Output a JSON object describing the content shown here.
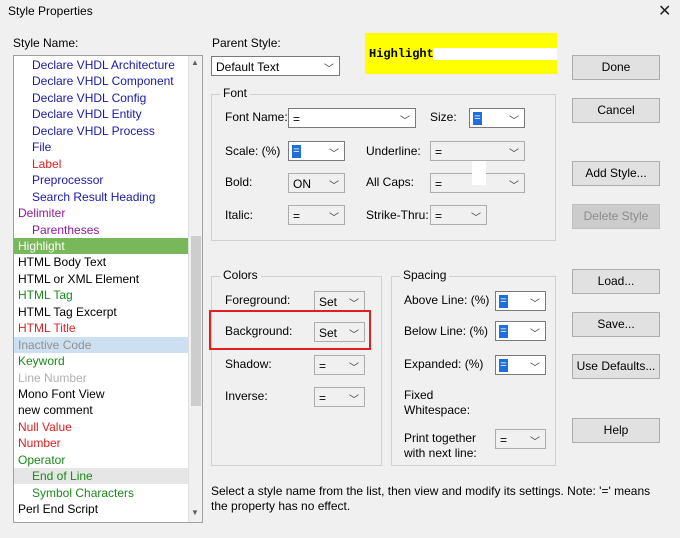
{
  "window": {
    "title": "Style Properties",
    "close_glyph": "✕"
  },
  "style_list": {
    "label": "Style Name:",
    "items": [
      {
        "label": "Declare VHDL Architecture",
        "color": "#1a1aa6",
        "indent": true
      },
      {
        "label": "Declare VHDL Component",
        "color": "#1a1aa6",
        "indent": true
      },
      {
        "label": "Declare VHDL Config",
        "color": "#1a1aa6",
        "indent": true
      },
      {
        "label": "Declare VHDL Entity",
        "color": "#1a1aa6",
        "indent": true
      },
      {
        "label": "Declare VHDL Process",
        "color": "#1a1aa6",
        "indent": true
      },
      {
        "label": "File",
        "color": "#1a1aa6",
        "indent": true
      },
      {
        "label": "Label",
        "color": "#e02020",
        "indent": true
      },
      {
        "label": "Preprocessor",
        "color": "#1a1aa6",
        "indent": true
      },
      {
        "label": "Search Result Heading",
        "color": "#1a1aa6",
        "indent": true
      },
      {
        "label": "Delimiter",
        "color": "#8b1a9b",
        "indent": false
      },
      {
        "label": "Parentheses",
        "color": "#8b1a9b",
        "indent": true
      },
      {
        "label": "Highlight",
        "color": "#ffffff",
        "indent": false,
        "selected": "green"
      },
      {
        "label": "HTML Body Text",
        "color": "#000000",
        "indent": false
      },
      {
        "label": "HTML or XML Element",
        "color": "#000000",
        "indent": false
      },
      {
        "label": "HTML Tag",
        "color": "#1a8a1a",
        "indent": false
      },
      {
        "label": "HTML Tag Excerpt",
        "color": "#000000",
        "indent": false
      },
      {
        "label": "HTML Title",
        "color": "#e02020",
        "indent": false
      },
      {
        "label": "Inactive Code",
        "color": "#909090",
        "indent": false,
        "selected": "blue"
      },
      {
        "label": "Keyword",
        "color": "#1a8a1a",
        "indent": false
      },
      {
        "label": "Line Number",
        "color": "#b0b0b0",
        "indent": false
      },
      {
        "label": "Mono Font View",
        "color": "#000000",
        "indent": false
      },
      {
        "label": "new comment",
        "color": "#000000",
        "indent": false
      },
      {
        "label": "Null Value",
        "color": "#e02020",
        "indent": false
      },
      {
        "label": "Number",
        "color": "#e02020",
        "indent": false
      },
      {
        "label": "Operator",
        "color": "#1a8a1a",
        "indent": false
      },
      {
        "label": "End of Line",
        "color": "#1a8a1a",
        "indent": true,
        "selected": "gray"
      },
      {
        "label": "Symbol Characters",
        "color": "#1a8a1a",
        "indent": true
      },
      {
        "label": "Perl End Script",
        "color": "#000000",
        "indent": false
      }
    ]
  },
  "parent_style": {
    "label": "Parent Style:",
    "value": "Default Text"
  },
  "preview": {
    "text": "Highlight"
  },
  "font": {
    "group_label": "Font",
    "font_name_label": "Font Name:",
    "font_name_value": "=",
    "size_label": "Size:",
    "size_value": "=",
    "scale_label": "Scale: (%)",
    "scale_value": "=",
    "underline_label": "Underline:",
    "underline_value": "=",
    "bold_label": "Bold:",
    "bold_value": "ON",
    "allcaps_label": "All Caps:",
    "allcaps_value": "=",
    "italic_label": "Italic:",
    "italic_value": "=",
    "strike_label": "Strike-Thru:",
    "strike_value": "="
  },
  "colors": {
    "group_label": "Colors",
    "foreground_label": "Foreground:",
    "foreground_value": "Set",
    "background_label": "Background:",
    "background_value": "Set",
    "shadow_label": "Shadow:",
    "shadow_value": "=",
    "inverse_label": "Inverse:",
    "inverse_value": "="
  },
  "spacing": {
    "group_label": "Spacing",
    "above_label": "Above Line: (%)",
    "above_value": "=",
    "below_label": "Below Line: (%)",
    "below_value": "=",
    "expanded_label": "Expanded: (%)",
    "expanded_value": "=",
    "fixed_ws_label_1": "Fixed",
    "fixed_ws_label_2": "Whitespace:",
    "print_together_label_1": "Print together",
    "print_together_label_2": "with next line:",
    "print_together_value": "="
  },
  "buttons": {
    "done": "Done",
    "cancel": "Cancel",
    "add_style": "Add Style...",
    "delete_style": "Delete Style",
    "load": "Load...",
    "save": "Save...",
    "use_defaults": "Use Defaults...",
    "help": "Help"
  },
  "info_line_1": "Select a style name from the list, then view and modify its settings. Note: '=' means",
  "info_line_2": "the property has no effect."
}
